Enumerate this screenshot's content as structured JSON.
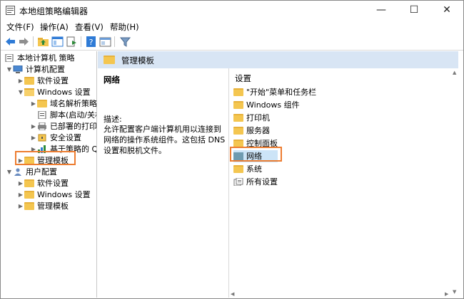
{
  "window": {
    "title": "本地组策略编辑器",
    "minimize": "—",
    "maximize": "☐",
    "close": "✕"
  },
  "menu": [
    "文件(F)",
    "操作(A)",
    "查看(V)",
    "帮助(H)"
  ],
  "tree": {
    "root": "本地计算机 策略",
    "computer": "计算机配置",
    "software": "软件设置",
    "windows_settings": "Windows 设置",
    "dns": "域名解析策略",
    "scripts": "脚本(启动/关机)",
    "printers": "已部署的打印机",
    "security": "安全设置",
    "qos": "基于策略的 Q",
    "admin_templates": "管理模板",
    "user": "用户配置",
    "user_software": "软件设置",
    "user_windows": "Windows 设置",
    "user_admin": "管理模板"
  },
  "right": {
    "header": "管理模板",
    "desc_title": "网络",
    "desc_label": "描述:",
    "desc_text": "允许配置客户端计算机用以连接到网络的操作系统组件。这包括 DNS 设置和脱机文件。",
    "list_header": "设置",
    "items": [
      "\"开始\"菜单和任务栏",
      "Windows 组件",
      "打印机",
      "服务器",
      "控制面板",
      "网络",
      "系统",
      "所有设置"
    ]
  },
  "colors": {
    "highlight": "#ed7d31",
    "selection": "#cce4f7",
    "header": "#d8e5f4",
    "folder": "#f4c650"
  }
}
